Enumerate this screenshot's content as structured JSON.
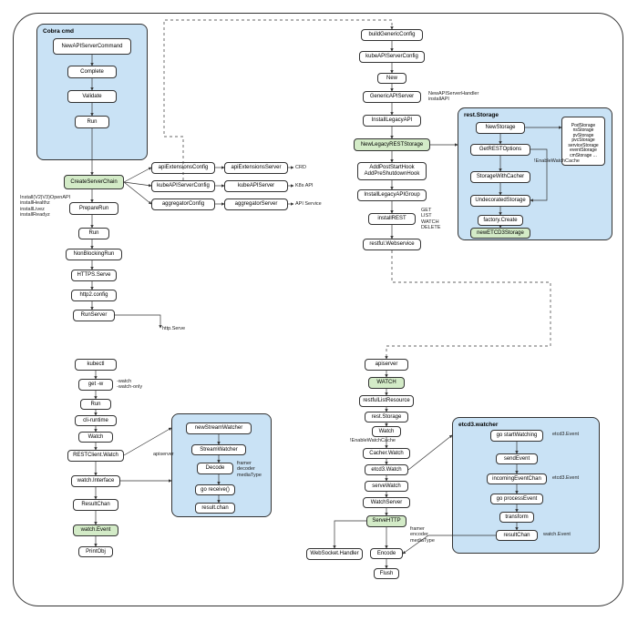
{
  "groups": {
    "cobra": {
      "title": "Cobra cmd"
    },
    "rest_storage": {
      "title": "rest.Storage"
    },
    "stream": {
      "title": ""
    },
    "etcd_watcher": {
      "title": "etcd3.watcher"
    }
  },
  "nodes": {
    "new_api_server_command": "NewAPIServerCommand",
    "complete": "Complete",
    "validate": "Validate",
    "run1": "Run",
    "create_server_chain": "CreateServerChain",
    "api_ext_config": "apiExtensionsConfig",
    "api_ext_server": "apiExtensionsServer",
    "kube_config": "kubeAPIServerConfig",
    "kube_server": "kubeAPIServer",
    "agg_config": "aggregatorConfig",
    "agg_server": "aggregatorServer",
    "prepare_run": "PrepareRun",
    "run2": "Run",
    "non_blocking_run": "NonBlockingRun",
    "https_serve": "HTTPS.Serve",
    "http2_config": "http2.config",
    "run_server": "RunServer",
    "http_serve": "http.Serve",
    "build_generic": "buildGenericConfig",
    "kube_api_server_config": "kubeAPIServerConfig",
    "new_generic": "New",
    "generic_api_server": "GenericAPIServer",
    "install_legacy_api": "InstallLegacyAPI",
    "new_legacy_rest": "NewLegacyRESTStorage",
    "add_post_start": "AddPostStartHook\nAddPreShutdownHook",
    "install_legacy_group": "InstallLegacyAPIGroup",
    "install_rest": "installREST",
    "restful_ws": "restful.Webservice",
    "new_storage": "NewStorage",
    "get_rest_options": "GetRESTOptions",
    "storage_with_cacher": "StorageWithCacher",
    "undecorated_storage": "UndecoratedStorage",
    "factory_create": "factory.Create",
    "new_etcd3_storage": "newETCD3Storage",
    "kubectl": "kubectl",
    "get_w": "get -w",
    "run3": "Run",
    "cli_runtime": "cli-runtime",
    "watch_cli": "Watch",
    "rest_client_watch": "RESTClient.Watch",
    "watch_interface": "watch.Interface",
    "result_chan_cli": "ResultChan",
    "watch_event_cli": "watch.Event",
    "print_obj": "PrintObj",
    "new_stream_watcher": "newStreamWatcher",
    "stream_watcher": "StreamWatcher",
    "decode": "Decode",
    "go_receive": "go receive()",
    "result_chan_stream": "result.chan",
    "apiserver_bottom": "apiserver",
    "watch_api": "WATCH",
    "restful_list": "restfulListResource",
    "rest_storage_node": "rest.Storage",
    "watch_srv": "Watch",
    "cacher_watch": "Cacher.Watch",
    "etcd3_watch": "etcd3.Watch",
    "serve_watch": "serveWatch",
    "watch_server": "WatchServer",
    "serve_http": "ServeHTTP",
    "encode": "Encode",
    "flush": "Flush",
    "websocket_handler": "WebSocket.Handler",
    "go_start_watching": "go startWatching",
    "send_event": "sendEvent",
    "incoming_event_chan": "incomingEventChan",
    "go_process_event": "go processEvent",
    "transform": "transform",
    "result_chan_etcd": "resultChan"
  },
  "labels": {
    "crd": "CRD",
    "k8s_api": "K8s API",
    "api_service": "API Service",
    "install_openapi": "Install(V2|V3)OpenAPI\ninstallHealthz\ninstallLivez\ninstallReadyz",
    "new_api_server_handler": "NewAPIServerHandler\ninstallAPI",
    "verbs": "GET\nLIST\nWATCH\nDELETE",
    "storage_types": "PodStorage\nnsStorage\npvStorage\npvcStorage\nserviceStorage\neventStorage\ncmStorage\n...",
    "enable_watch_cache1": "!EnableWatchCache",
    "apiserver_label": "apiserver",
    "watch_only": "-watch\n-watch-only",
    "framer": "framer\ndecoder\nmediaType",
    "enable_watch_cache2": "!EnableWatchCache",
    "framer_encoder": "framer\nencoder\nmediaType",
    "etcd3_event": "etcd3.Event",
    "etcd3_event2": "etcd3.Event",
    "watch_event_lbl": "watch.Event"
  }
}
